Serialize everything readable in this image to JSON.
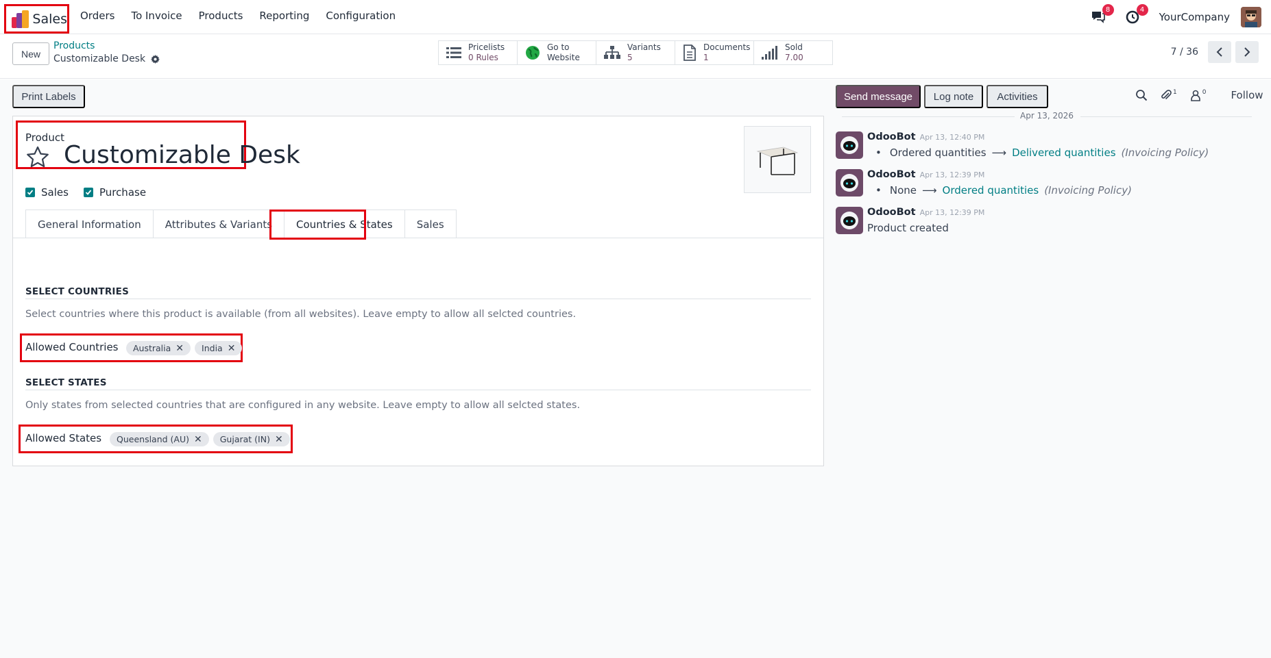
{
  "app": {
    "name": "Sales"
  },
  "menu": [
    "Orders",
    "To Invoice",
    "Products",
    "Reporting",
    "Configuration"
  ],
  "systray": {
    "messages_count": "8",
    "activities_count": "4",
    "company": "YourCompany"
  },
  "control": {
    "new_label": "New",
    "breadcrumb_parent": "Products",
    "breadcrumb_current": "Customizable Desk",
    "stats": [
      {
        "label": "Pricelists",
        "value": "0 Rules",
        "icon": "list-icon"
      },
      {
        "label": "Go to",
        "value": "Website",
        "icon": "globe-icon"
      },
      {
        "label": "Variants",
        "value": "5",
        "icon": "sitemap-icon"
      },
      {
        "label": "Documents",
        "value": "1",
        "icon": "file-icon"
      },
      {
        "label": "Sold",
        "value": "7.00",
        "icon": "signal-icon"
      }
    ],
    "pager": "7 / 36"
  },
  "form": {
    "print_labels": "Print Labels",
    "product_label": "Product",
    "product_name": "Customizable Desk",
    "checks": [
      {
        "label": "Sales",
        "checked": true
      },
      {
        "label": "Purchase",
        "checked": true
      }
    ],
    "tabs": [
      "General Information",
      "Attributes & Variants",
      "Countries & States",
      "Sales"
    ],
    "active_tab": "Countries & States",
    "countries_section": {
      "title": "SELECT COUNTRIES",
      "help": "Select countries where this product is available (from all websites). Leave empty to allow all selcted countries.",
      "field_label": "Allowed Countries",
      "tags": [
        "Australia",
        "India"
      ]
    },
    "states_section": {
      "title": "SELECT STATES",
      "help": "Only states from selected countries that are configured in any website. Leave empty to allow all selcted states.",
      "field_label": "Allowed States",
      "tags": [
        "Queensland (AU)",
        "Gujarat (IN)"
      ]
    }
  },
  "chatter": {
    "send_message": "Send message",
    "log_note": "Log note",
    "activities": "Activities",
    "attachments_count": "1",
    "followers_count": "0",
    "follow": "Follow",
    "date": "Apr 13, 2026",
    "messages": [
      {
        "author": "OdooBot",
        "date": "Apr 13, 12:40 PM",
        "old": "Ordered quantities",
        "new": "Delivered quantities",
        "field": "(Invoicing Policy)"
      },
      {
        "author": "OdooBot",
        "date": "Apr 13, 12:39 PM",
        "old": "None",
        "new": "Ordered quantities",
        "field": "(Invoicing Policy)"
      },
      {
        "author": "OdooBot",
        "date": "Apr 13, 12:39 PM",
        "text": "Product created"
      }
    ]
  },
  "colors": {
    "accent": "#714b67",
    "link": "#017e84",
    "highlight": "#e3000f",
    "badge": "#e3264a"
  }
}
